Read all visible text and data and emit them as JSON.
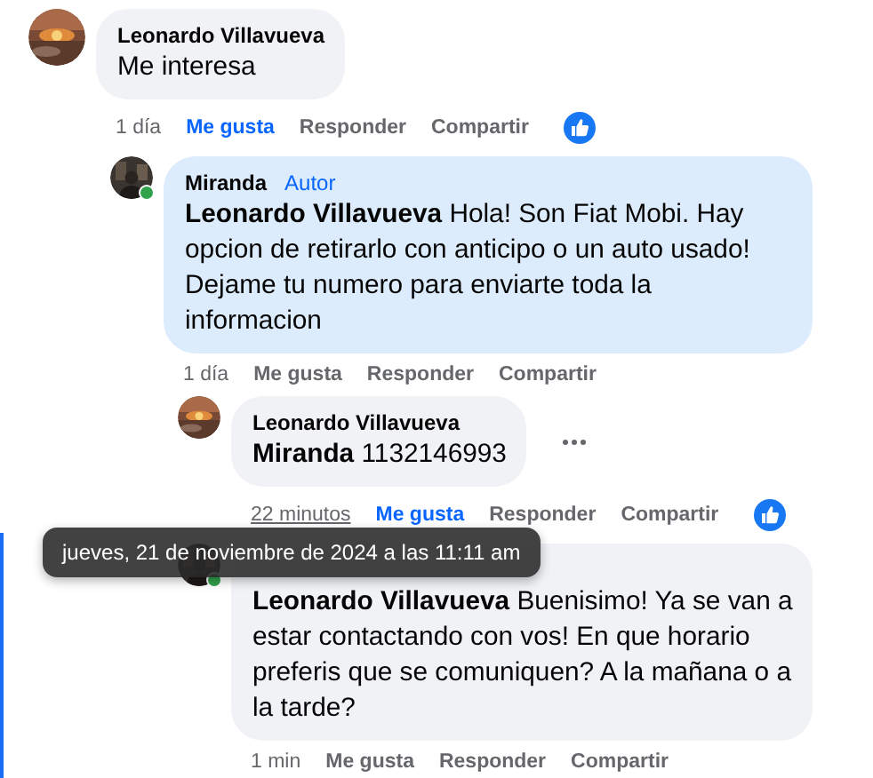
{
  "comments": [
    {
      "author": "Leonardo Villavueva",
      "online": false,
      "highlighted": false,
      "text": "Me interesa",
      "time": "1 día",
      "time_underlined": false,
      "actions": [
        "Me gusta",
        "Responder",
        "Compartir"
      ],
      "liked": true,
      "reacted": true,
      "more": false,
      "children": [
        {
          "author": "Miranda",
          "online": true,
          "badge": "Autor",
          "highlighted": true,
          "text": "**Leonardo Villavueva** Hola! Son Fiat Mobi. Hay opcion de retirarlo con anticipo o un auto usado! Dejame tu numero para enviarte toda la informacion",
          "time": "1 día",
          "time_underlined": false,
          "actions": [
            "Me gusta",
            "Responder",
            "Compartir"
          ],
          "liked": false,
          "reacted": false,
          "more": false,
          "children": [
            {
              "author": "Leonardo Villavueva",
              "online": false,
              "highlighted": false,
              "text": "**Miranda** 1132146993",
              "time": "22 minutos",
              "time_underlined": true,
              "actions": [
                "Me gusta",
                "Responder",
                "Compartir"
              ],
              "liked": true,
              "reacted": true,
              "more": true
            },
            {
              "online": true,
              "highlighted": false,
              "text": "**Leonardo Villavueva** Buenisimo! Ya se van a estar contactando con vos! En que horario preferis que se comuniquen? A la mañana o a la tarde?",
              "time": "1 min",
              "time_underlined": false,
              "actions": [
                "Me gusta",
                "Responder",
                "Compartir"
              ],
              "liked": false,
              "reacted": false,
              "more": false
            }
          ]
        }
      ]
    }
  ],
  "tooltip": {
    "text": "jueves, 21 de noviembre de 2024 a las 11:11 am"
  },
  "selection_bar": true
}
